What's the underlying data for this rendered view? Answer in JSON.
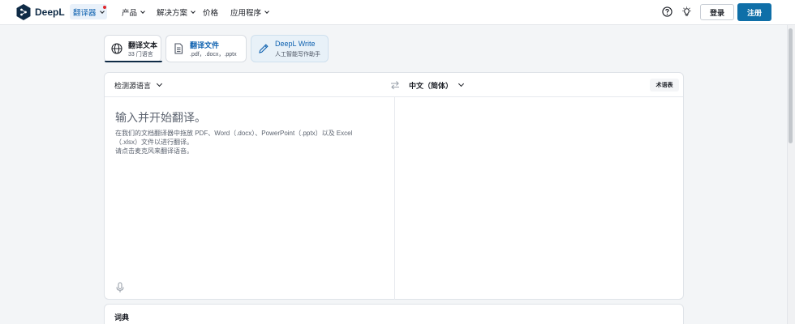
{
  "header": {
    "brand": "DeepL",
    "nav": {
      "translator": "翻译器",
      "products": "产品",
      "solutions": "解决方案",
      "pricing": "价格",
      "apps": "应用程序"
    },
    "login_label": "登录",
    "signup_label": "注册",
    "icons": [
      "help-icon",
      "lightbulb-icon"
    ]
  },
  "mode_tabs": [
    {
      "title": "翻译文本",
      "subtitle": "33 门语言",
      "icon": "globe-icon"
    },
    {
      "title": "翻译文件",
      "subtitle": ".pdf，.docx，.pptx",
      "icon": "document-icon"
    },
    {
      "title": "DeepL Write",
      "subtitle": "人工智能写作助手",
      "icon": "pen-icon"
    }
  ],
  "translator": {
    "source_lang": "检测源语言",
    "target_lang": "中文（简体）",
    "glossary_label": "术语表",
    "placeholder": "输入并开始翻译。",
    "hint_line1": "在我们的文档翻译器中拖放 PDF、Word（.docx）、PowerPoint（.pptx）以及 Excel（.xlsx）文件以进行翻译。",
    "hint_line2": "请点击麦克风来翻译语音。"
  },
  "dictionary": {
    "title": "词典"
  },
  "colors": {
    "brand_navy": "#0f2b46",
    "accent_blue": "#0f62b0",
    "signup_blue": "#0f6fa8",
    "notification_red": "#e0262b"
  }
}
